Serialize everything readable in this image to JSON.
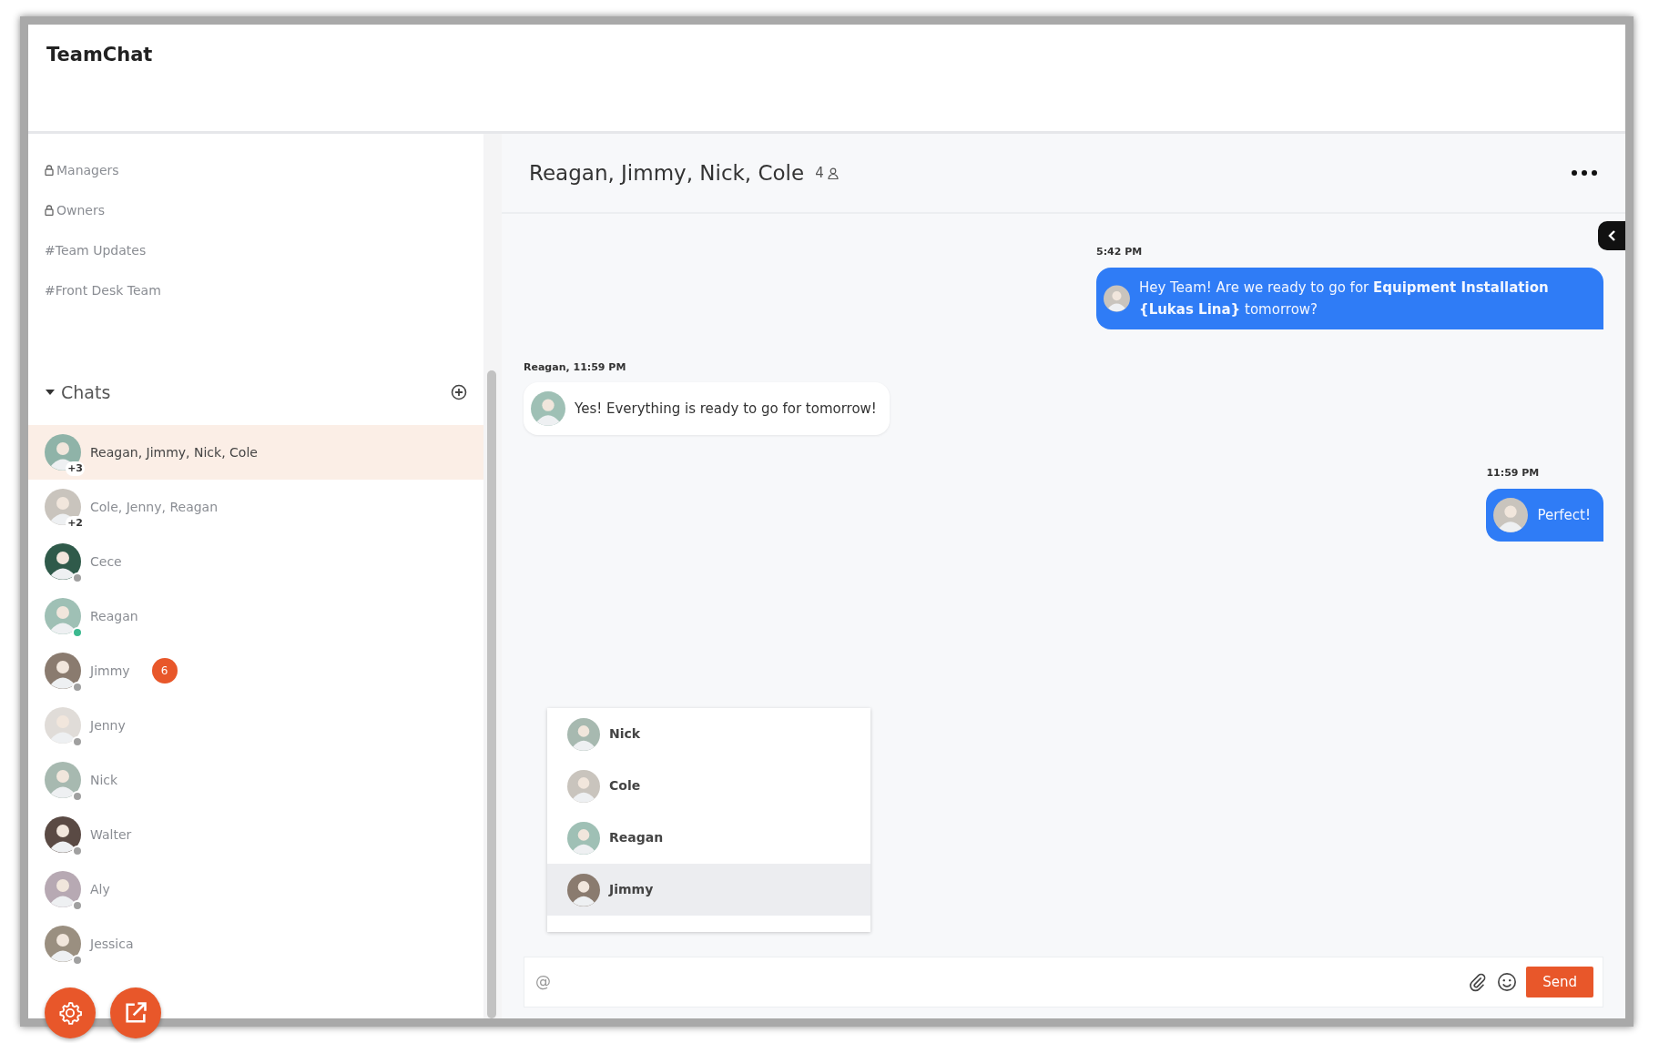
{
  "app": {
    "title": "TeamChat"
  },
  "channels": [
    {
      "kind": "private",
      "label": "Managers"
    },
    {
      "kind": "private",
      "label": "Owners"
    },
    {
      "kind": "public",
      "label": "#Team Updates"
    },
    {
      "kind": "public",
      "label": "#Front Desk Team"
    }
  ],
  "chats_section": {
    "title": "Chats",
    "expanded": true
  },
  "chats": [
    {
      "kind": "group",
      "name": "Reagan, Jimmy, Nick, Cole",
      "extra": "+3",
      "selected": true
    },
    {
      "kind": "group",
      "name": "Cole, Jenny, Reagan",
      "extra": "+2",
      "selected": false
    },
    {
      "kind": "direct",
      "name": "Cece",
      "color": "#a0a0a0",
      "selected": false
    },
    {
      "kind": "direct",
      "name": "Reagan",
      "color": "#3cb98f",
      "selected": false
    },
    {
      "kind": "direct",
      "name": "Jimmy",
      "color": "#a0a0a0",
      "unread": "6",
      "selected": false
    },
    {
      "kind": "direct",
      "name": "Jenny",
      "color": "#a0a0a0",
      "selected": false
    },
    {
      "kind": "direct",
      "name": "Nick",
      "color": "#a0a0a0",
      "selected": false
    },
    {
      "kind": "direct",
      "name": "Walter",
      "color": "#a0a0a0",
      "selected": false
    },
    {
      "kind": "direct",
      "name": "Aly",
      "color": "#a0a0a0",
      "selected": false
    },
    {
      "kind": "direct",
      "name": "Jessica",
      "color": "#a0a0a0",
      "selected": false
    }
  ],
  "conversation": {
    "title": "Reagan, Jimmy, Nick, Cole",
    "member_count": "4"
  },
  "messages": [
    {
      "kind": "outgoing",
      "meta": "5:42 PM",
      "text": "Hey Team! Are we ready to go for **Equipment Installation {Lukas Lina}** tomorrow?"
    },
    {
      "kind": "incoming",
      "meta": "Reagan, 11:59 PM",
      "text": "Yes!  Everything is ready to go for tomorrow!"
    },
    {
      "kind": "outgoing",
      "meta": "11:59 PM",
      "text": "Perfect!"
    }
  ],
  "mention_menu": [
    {
      "name": "Nick",
      "selected": false
    },
    {
      "name": "Cole",
      "selected": false
    },
    {
      "name": "Reagan",
      "selected": false
    },
    {
      "name": "Jimmy",
      "selected": true
    }
  ],
  "composer": {
    "value": "@",
    "send": "Send"
  }
}
